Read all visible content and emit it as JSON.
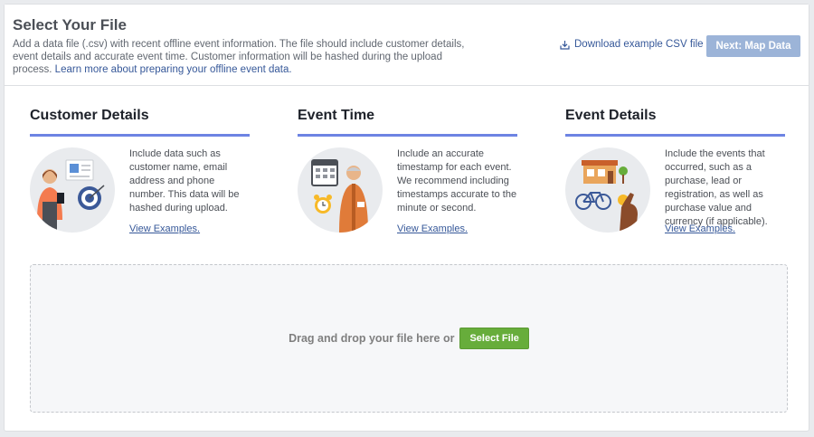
{
  "header": {
    "title": "Select Your File",
    "description": "Add a data file (.csv) with recent offline event information. The file should include customer details, event details and accurate event time. Customer information will be hashed during the upload process.",
    "learn_more_link": "Learn more about preparing your offline event data.",
    "download_link": "Download example CSV file",
    "next_button": "Next: Map Data"
  },
  "columns": [
    {
      "title": "Customer Details",
      "text": "Include data such as customer name, email address and phone number. This data will be hashed during upload.",
      "link": "View Examples."
    },
    {
      "title": "Event Time",
      "text": "Include an accurate timestamp for each event. We recommend including timestamps accurate to the minute or second.",
      "link": "View Examples."
    },
    {
      "title": "Event Details",
      "text": "Include the events that occurred, such as a purchase, lead or registration, as well as purchase value and currency (if applicable).",
      "link": "View Examples."
    }
  ],
  "dropzone": {
    "text": "Drag and drop your file here or",
    "select_button": "Select File"
  },
  "colors": {
    "accent_underline": "#6d84e3",
    "link": "#365899",
    "next_button_disabled": "#9cb4d8",
    "select_button": "#67ad3b"
  },
  "icons": [
    "download-icon",
    "customer-illustration",
    "event-time-illustration",
    "event-details-illustration"
  ]
}
